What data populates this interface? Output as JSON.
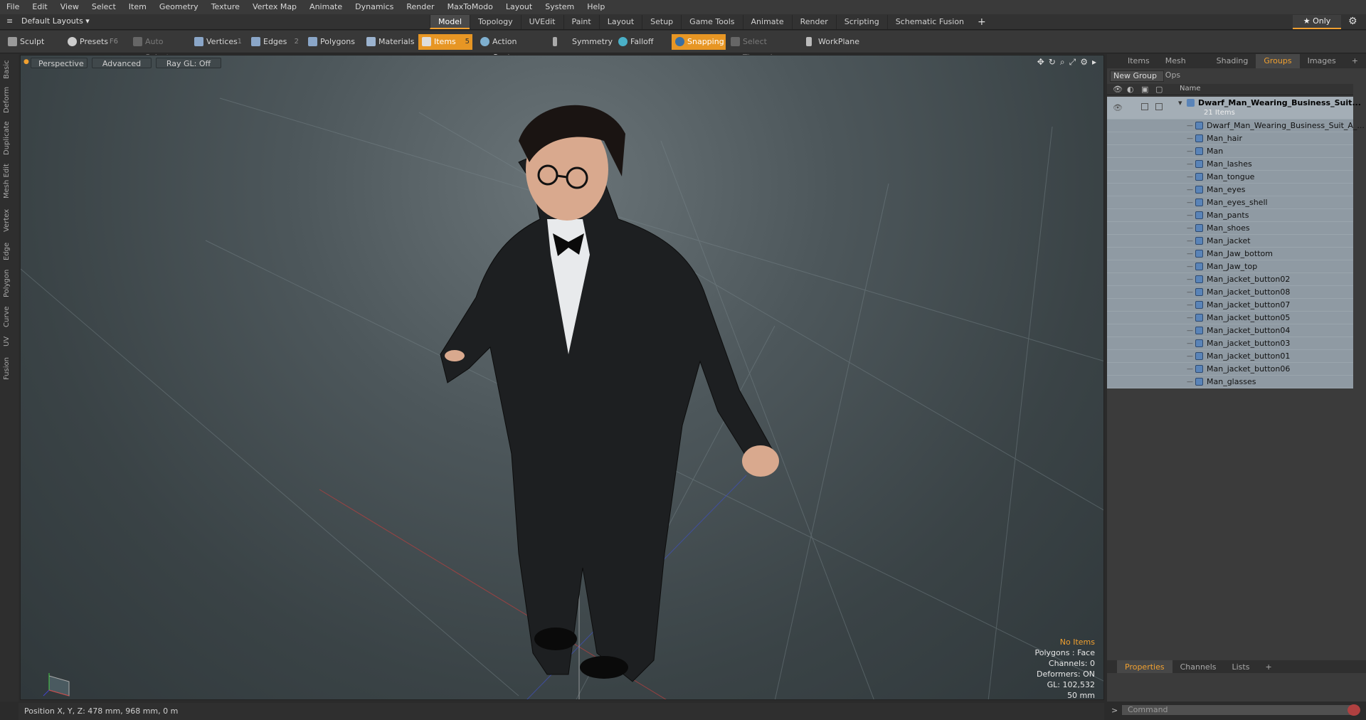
{
  "menu": [
    "File",
    "Edit",
    "View",
    "Select",
    "Item",
    "Geometry",
    "Texture",
    "Vertex Map",
    "Animate",
    "Dynamics",
    "Render",
    "MaxToModo",
    "Layout",
    "System",
    "Help"
  ],
  "layout_selector": "Default Layouts ▾",
  "top_tabs": [
    "Model",
    "Topology",
    "UVEdit",
    "Paint",
    "Layout",
    "Setup",
    "Game Tools",
    "Animate",
    "Render",
    "Scripting",
    "Schematic Fusion"
  ],
  "active_top_tab": "Model",
  "only_label": "★  Only",
  "toolbar": {
    "sculpt": "Sculpt",
    "presets": "Presets",
    "presets_key": "F6",
    "auto_select": "Auto Select",
    "vertices": "Vertices",
    "vertices_key": "1",
    "edges": "Edges",
    "edges_key": "2",
    "polygons": "Polygons",
    "materials": "Materials",
    "items": "Items",
    "items_key": "5",
    "action_center": "Action Center",
    "symmetry": "Symmetry",
    "falloff": "Falloff",
    "snapping": "Snapping",
    "select_through": "Select Through",
    "workplane": "WorkPlane"
  },
  "left_tabs": [
    "Basic",
    "Deform",
    "Duplicate",
    "Mesh Edit",
    "Vertex",
    "Edge",
    "Polygon",
    "Curve",
    "UV",
    "Fusion"
  ],
  "viewport": {
    "mode": "Perspective",
    "shading": "Advanced",
    "raygl": "Ray GL: Off",
    "info": [
      "No Items",
      "Polygons : Face",
      "Channels: 0",
      "Deformers: ON",
      "GL: 102,532",
      "50 mm"
    ]
  },
  "right_panel": {
    "tabs": [
      "Items",
      "Mesh Ops",
      "Shading",
      "Groups",
      "Images"
    ],
    "active_tab": "Groups",
    "new_group": "New Group",
    "column_name": "Name",
    "group_name": "Dwarf_Man_Wearing_Business_Suit...",
    "group_count": "21 Items",
    "items": [
      "Dwarf_Man_Wearing_Business_Suit_A_...",
      "Man_hair",
      "Man",
      "Man_lashes",
      "Man_tongue",
      "Man_eyes",
      "Man_eyes_shell",
      "Man_pants",
      "Man_shoes",
      "Man_jacket",
      "Man_Jaw_bottom",
      "Man_Jaw_top",
      "Man_jacket_button02",
      "Man_jacket_button08",
      "Man_jacket_button07",
      "Man_jacket_button05",
      "Man_jacket_button04",
      "Man_jacket_button03",
      "Man_jacket_button01",
      "Man_jacket_button06",
      "Man_glasses"
    ],
    "bottom_tabs": [
      "Properties",
      "Channels",
      "Lists"
    ],
    "command_placeholder": "Command"
  },
  "status": "Position X, Y, Z:  478 mm, 968 mm, 0 m"
}
